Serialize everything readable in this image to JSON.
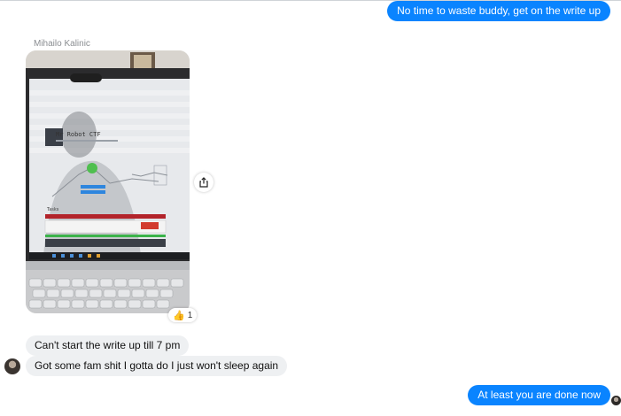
{
  "messages": {
    "outgoing_1": "No time to waste buddy, get on the write up",
    "sender_name": "Mihailo Kalinic",
    "reaction": {
      "icon": "thumbs-up-icon",
      "count": "1"
    },
    "incoming_1": "Can't start the write up till 7 pm",
    "incoming_2": "Got some fam shit I gotta do I just won't sleep again",
    "outgoing_2": "At least you are done now"
  },
  "photo": {
    "screen_title": "Mr Robot CTF",
    "screen_section": "Tasks"
  },
  "colors": {
    "outgoing_bubble": "#0a84ff",
    "incoming_bubble": "#eef0f2"
  }
}
